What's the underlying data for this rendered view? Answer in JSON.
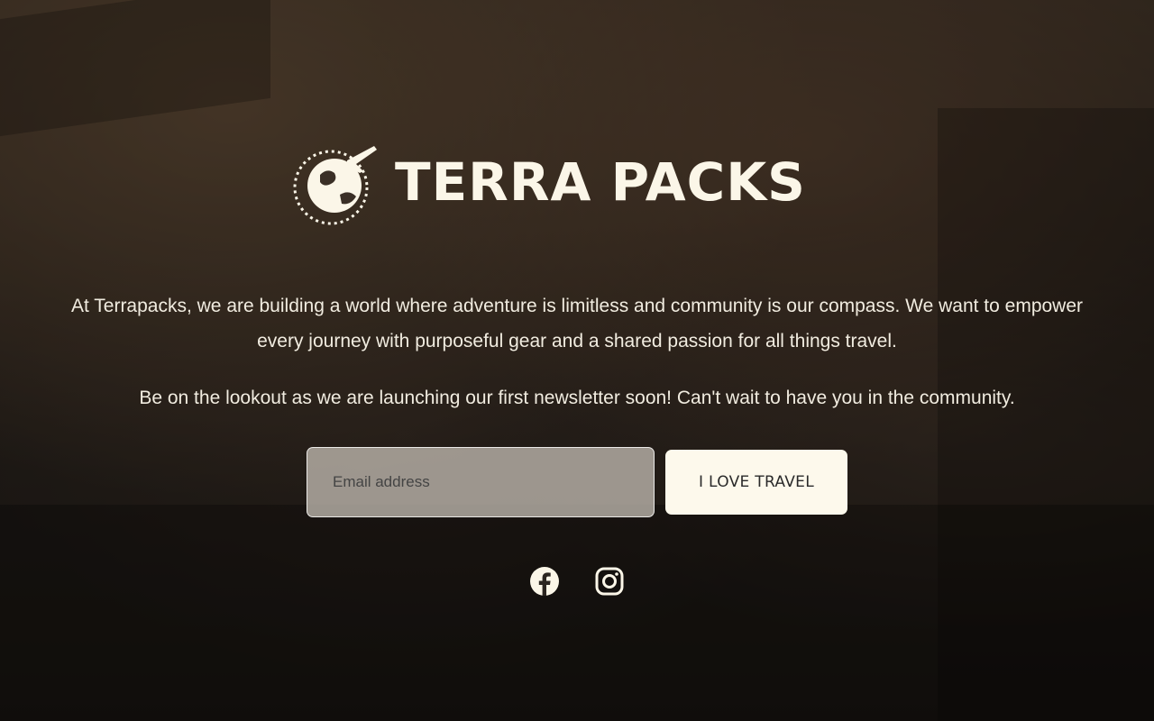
{
  "brand": {
    "name": "TERRA PACKS",
    "logo_icon": "globe-plane-icon"
  },
  "intro_text": "At Terrapacks, we are building a world where adventure is limitless and community is our compass. We want to empower every journey with purposeful gear and a shared passion for all things travel.",
  "launch_text": "Be on the lookout as we are launching our first newsletter soon! Can't wait to have you in the community.",
  "signup": {
    "email_placeholder": "Email address",
    "email_value": "",
    "button_label": "I LOVE TRAVEL"
  },
  "social": [
    {
      "name": "facebook",
      "icon": "facebook-icon"
    },
    {
      "name": "instagram",
      "icon": "instagram-icon"
    }
  ],
  "colors": {
    "text": "#f1ece0",
    "button_bg": "#fdf9ec",
    "button_text": "#2a2a2a",
    "input_bg": "#cdc6bc"
  }
}
